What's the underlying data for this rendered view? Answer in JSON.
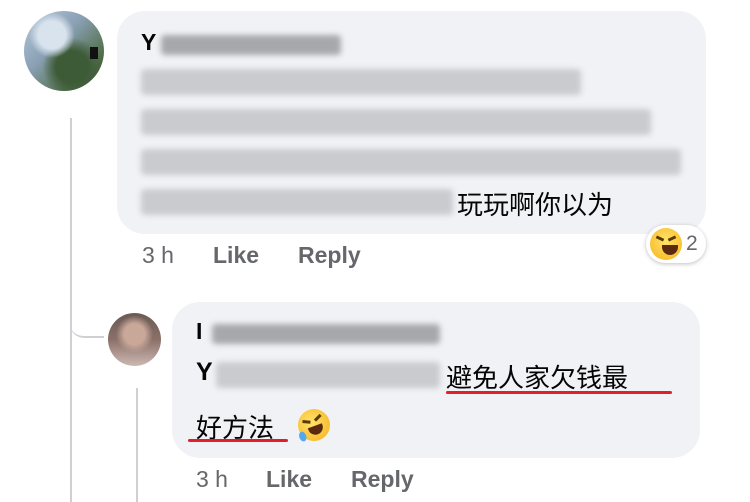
{
  "comment1": {
    "author_initial": "Y",
    "text_visible": "玩玩啊你以为",
    "time": "3 h",
    "like_label": "Like",
    "reply_label": "Reply",
    "reaction": {
      "icon": "laughing-emoji-icon",
      "count": "2"
    }
  },
  "comment2": {
    "author_initial": "I",
    "mention_initial": "Y",
    "text_line1": "避免人家欠钱最",
    "text_line2": "好方法",
    "emoji": "rolling-on-floor-laughing-emoji-icon",
    "time": "3 h",
    "like_label": "Like",
    "reply_label": "Reply"
  },
  "colors": {
    "bubble": "#f0f2f5",
    "meta_text": "#65676b",
    "underline": "#e41e28",
    "thread": "#ced0d4"
  }
}
